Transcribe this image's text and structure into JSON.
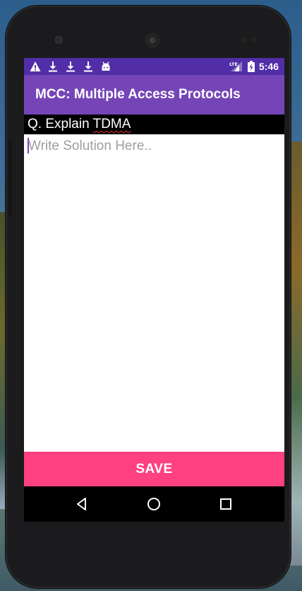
{
  "status_bar": {
    "time": "5:46",
    "network": "LTE",
    "left_icons": [
      "warning-icon",
      "download-icon",
      "download-icon",
      "download-icon",
      "android-icon"
    ],
    "right_icons": [
      "signal-icon",
      "battery-charging-icon"
    ]
  },
  "app_bar": {
    "title": "MCC: Multiple Access Protocols"
  },
  "question": {
    "prefix": "Q. Explain ",
    "term": "TDMA"
  },
  "editor": {
    "placeholder": "Write Solution Here..",
    "value": ""
  },
  "save_button": {
    "label": "SAVE"
  },
  "nav_bar": {
    "buttons": [
      "back-icon",
      "home-icon",
      "recents-icon"
    ]
  },
  "colors": {
    "status_bar": "#512da8",
    "app_bar": "#7545b7",
    "accent": "#ff4081",
    "cursor": "#7b3fb8"
  }
}
